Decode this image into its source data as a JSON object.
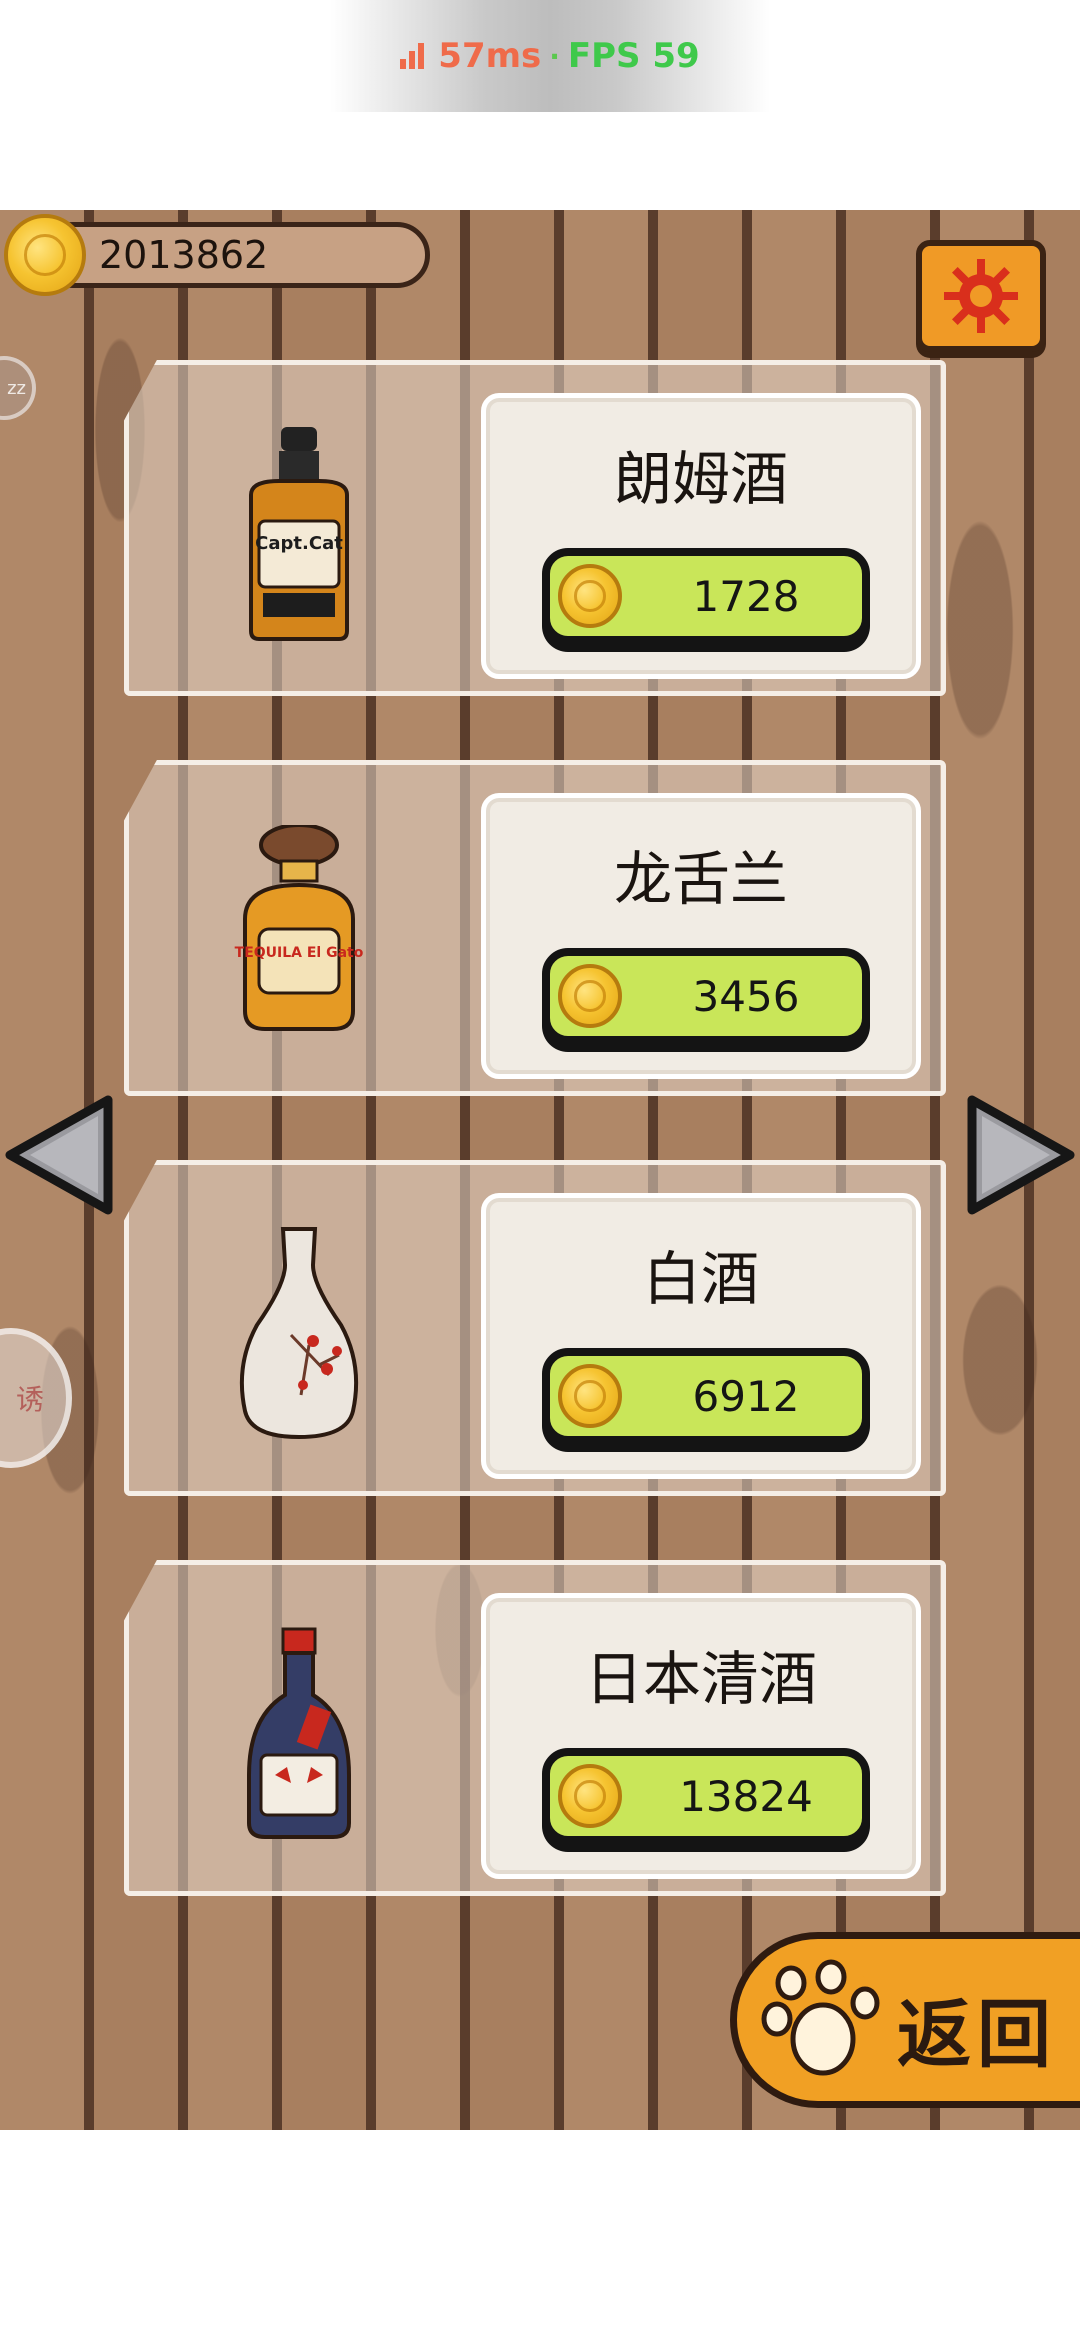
{
  "overlay": {
    "ping": "57ms",
    "separator": "·",
    "fps": "FPS 59"
  },
  "coins": {
    "balance": "2013862"
  },
  "side": {
    "ring_text": "zz",
    "disc_text": "诱"
  },
  "shop": {
    "items": [
      {
        "name": "朗姆酒",
        "price": "1728",
        "bottle_label": "Capt.Cat"
      },
      {
        "name": "龙舌兰",
        "price": "3456",
        "bottle_label": "TEQUILA El Gato"
      },
      {
        "name": "白酒",
        "price": "6912",
        "bottle_label": ""
      },
      {
        "name": "日本清酒",
        "price": "13824",
        "bottle_label": ""
      }
    ]
  },
  "back_label": "返回",
  "colors": {
    "wood": "#b08868",
    "button_green": "#c9e659",
    "orange": "#f09a26",
    "coin": "#f6c431"
  }
}
